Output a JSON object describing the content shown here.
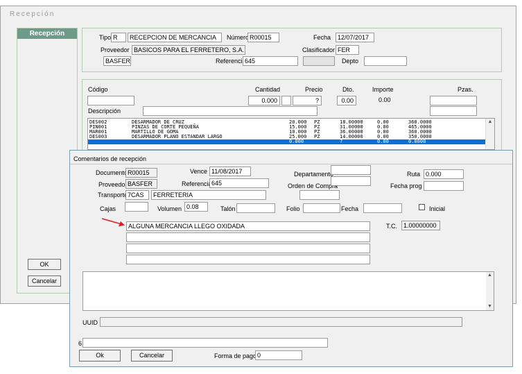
{
  "main": {
    "title": "Recepción",
    "side_title": "Recepción",
    "ok": "OK",
    "cancel": "Cancelar",
    "tipo_label": "Tipo",
    "tipo": "R",
    "tipo_desc": "RECEPCION DE MERCANCIA",
    "numero_label": "Número",
    "numero": "R00015",
    "fecha_label": "Fecha",
    "fecha": "12/07/2017",
    "proveedor_label": "Proveedor",
    "proveedor_name": "BASICOS PARA EL FERRETERO, S.A.",
    "clasificador_label": "Clasificador",
    "clasificador": "FER",
    "proveedor_code": "BASFER",
    "referencia_label": "Referencia",
    "referencia": "645",
    "depto_label": "Depto",
    "depto": "",
    "grid": {
      "codigo_label": "Código",
      "cantidad_label": "Cantidad",
      "precio_label": "Precio",
      "dto_label": "Dto.",
      "importe_label": "Importe",
      "pzas_label": "Pzas.",
      "descripcion_label": "Descripción",
      "cantidad": "0.000",
      "precio": "?",
      "dto": "0.00",
      "importe": "0.00",
      "rows": [
        {
          "code": "DES002",
          "desc": "DESARMADOR DE CRUZ",
          "qty": "20.000",
          "unit": "PZ",
          "price": "18.00000",
          "dto": "0.00",
          "amount": "360.0000"
        },
        {
          "code": "PIN001",
          "desc": "PINZAS DE CORTE PEQUEÑA",
          "qty": "15.000",
          "unit": "PZ",
          "price": "31.00000",
          "dto": "0.00",
          "amount": "465.0000"
        },
        {
          "code": "MAR001",
          "desc": "MARTILLO DE GOMA",
          "qty": "10.000",
          "unit": "PZ",
          "price": "36.00000",
          "dto": "0.00",
          "amount": "360.0000"
        },
        {
          "code": "DES003",
          "desc": "DESARMADOR PLANO ESTANDAR LARGO",
          "qty": "25.000",
          "unit": "PZ",
          "price": "14.00000",
          "dto": "0.00",
          "amount": "350.0000"
        },
        {
          "code": "",
          "desc": "",
          "qty": "0.000",
          "unit": "",
          "price": "?",
          "dto": "0.00",
          "amount": "0.0000"
        }
      ]
    }
  },
  "dialog": {
    "title": "Comentarios de recepción",
    "documento_label": "Documento",
    "documento": "R00015",
    "vence_label": "Vence",
    "vence": "11/08/2017",
    "departamento_label": "Departamento",
    "departamento": "",
    "ruta_label": "Ruta",
    "ruta": "0.000",
    "proveedor_label": "Proveedor",
    "proveedor": "BASFER",
    "referencia_label": "Referencia",
    "referencia": "645",
    "orden_label": "Orden de Compra",
    "orden": "",
    "fecha_prog_label": "Fecha prog",
    "fecha_prog": "",
    "transporte_label": "Transporte",
    "transporte_code": "7CAS",
    "transporte_name": "FERRETERIA",
    "cajas_label": "Cajas",
    "cajas": "",
    "volumen_label": "Volumen",
    "volumen": "0.08",
    "talon_label": "Talón",
    "talon": "",
    "folio_label": "Folio",
    "folio": "",
    "fecha_label": "Fecha",
    "fecha": "",
    "inicial_label": "Inicial",
    "comment1": "ALGUNA MERCANCIA LLEGO OXIDADA",
    "comment2": "",
    "comment3": "",
    "comment4": "",
    "tc_label": "T.C.",
    "tc": "1.00000000",
    "uuid_label": "UUID",
    "uuid": "",
    "six_label": "6",
    "six": "",
    "ok": "Ok",
    "cancel": "Cancelar",
    "forma_pago_label": "Forma de pago",
    "forma_pago": "0"
  },
  "colors": {
    "accent": "#0a6fd6",
    "arrow": "#e02020",
    "side_header": "#6e9a8a"
  }
}
